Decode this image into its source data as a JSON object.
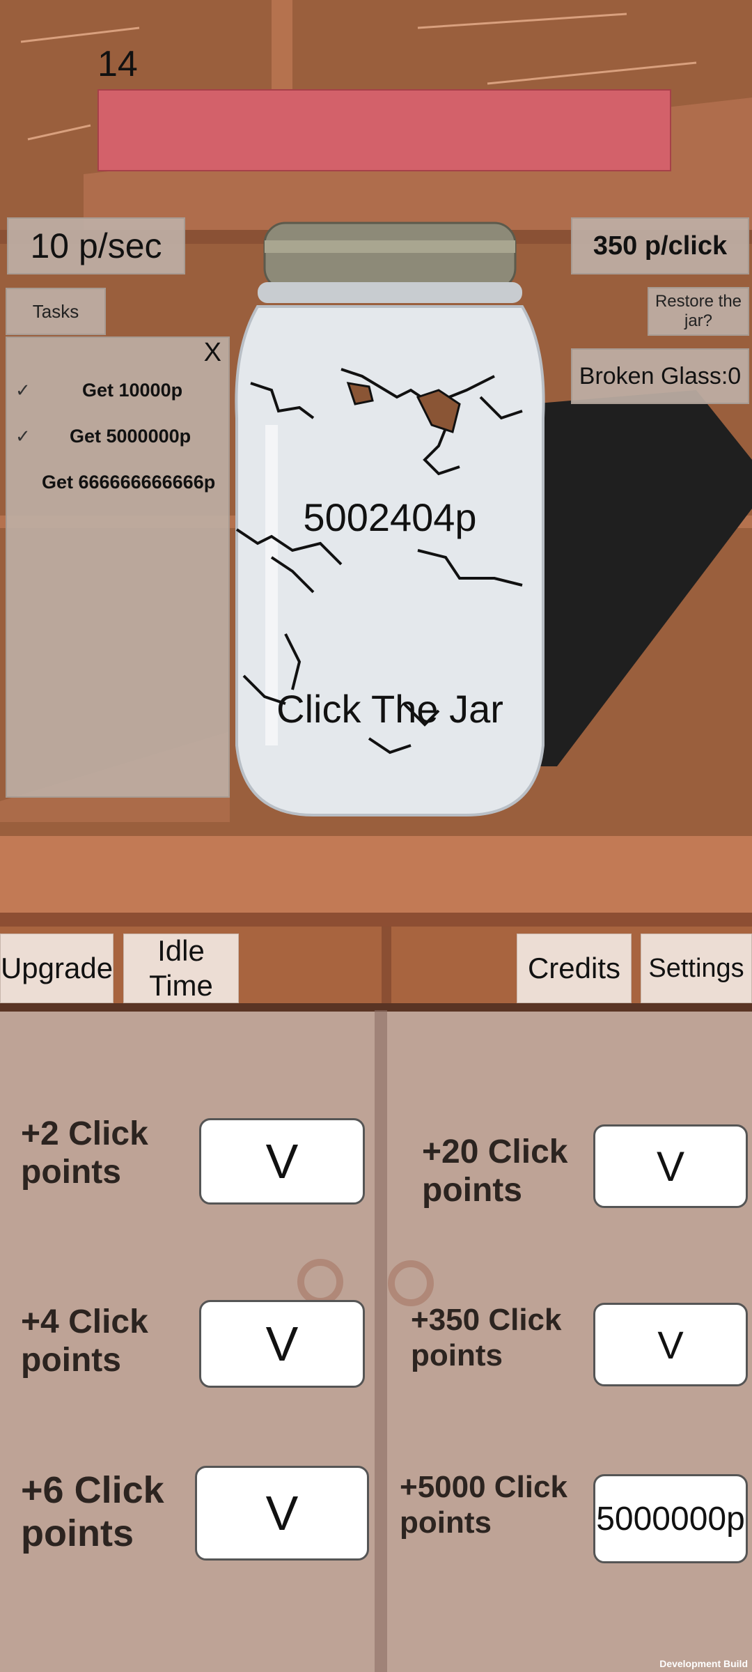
{
  "level": {
    "number": "14"
  },
  "stats": {
    "per_sec": "10 p/sec",
    "per_click": "350 p/click",
    "broken_glass": "Broken Glass:0"
  },
  "buttons": {
    "tasks": "Tasks",
    "restore": "Restore the jar?"
  },
  "tasks_panel": {
    "close": "X",
    "items": [
      {
        "label": "Get 10000p",
        "done": true
      },
      {
        "label": "Get 5000000p",
        "done": true
      },
      {
        "label": "Get 666666666666p",
        "done": false
      }
    ],
    "check_icon": "checkmark-icon"
  },
  "jar": {
    "score": "5002404p",
    "cta": "Click The Jar"
  },
  "nav": {
    "upgrade": "Upgrade",
    "idle": "Idle Time",
    "credits": "Credits",
    "settings": "Settings"
  },
  "upgrades": {
    "left": [
      {
        "label": "+2 Click points",
        "button": "V"
      },
      {
        "label": "+4 Click points",
        "button": "V"
      },
      {
        "label": "+6 Click points",
        "button": "V"
      }
    ],
    "right": [
      {
        "label": "+20 Click points",
        "button": "V"
      },
      {
        "label": "+350 Click points",
        "button": "V"
      },
      {
        "label": "+5000 Click points",
        "button": "5000000p"
      }
    ]
  },
  "footer": {
    "build": "Development Build"
  },
  "colors": {
    "level_bar": "#d3616a",
    "wood": "#9a5f3d",
    "panel": "#bea396"
  }
}
